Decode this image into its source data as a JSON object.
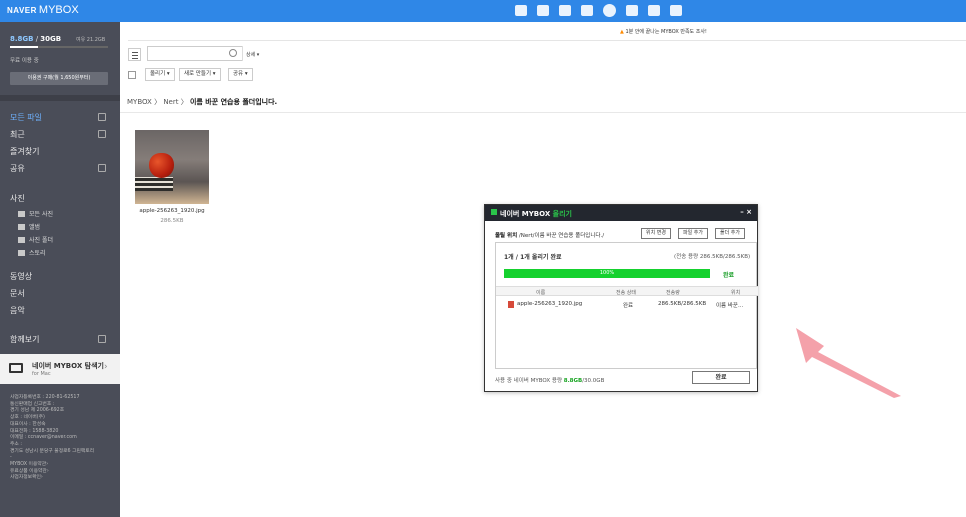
{
  "brand": {
    "naver": "NAVER",
    "mybox": "MYBOX"
  },
  "sidebar": {
    "quota_used": "8.8GB",
    "quota_sep": " / ",
    "quota_total": "30GB",
    "quota_small": "여유 21.2GB",
    "quota_fraction": 0.29,
    "free_text": "무료 이용 중",
    "buy_button": "이용권 구매(월 1,650원부터)",
    "nav": [
      "모든 파일",
      "최근",
      "즐겨찾기",
      "공유",
      "사진",
      "동영상",
      "문서",
      "음악",
      "함께보기"
    ],
    "photo_sub": [
      "모든 사진",
      "앨범",
      "사진 폴더",
      "스토리"
    ],
    "explorer_title": "네이버 MYBOX 탐색기",
    "explorer_sub": "for Mac",
    "footer": "사업자등록번호 : 220-81-62517\n통신판매업 신고번호 :\n경기 성남 제 2006-692호\n상호 : 네이버(주)\n대표이사 : 한성숙\n대표전화 : 1588-3820\n이메일 : ccnaver@naver.com\n주소 :\n경기도 성남시 분당구 불정로6 그린팩토리\n-\nMYBOX 이용약관›\n유료상품 이용약관›\n사업자정보확인›"
  },
  "notice": "1분 안에 끝나는 MYBOX 만족도 조사!",
  "toolbar": {
    "search_placeholder": "",
    "detail": "상세 ▾",
    "upload": "올리기 ▾",
    "new": "새로 만들기 ▾",
    "share": "공유 ▾"
  },
  "breadcrumb": {
    "root": "MYBOX",
    "sep": " 〉 ",
    "mid": "Nert",
    "current": "이름 바꾼 연습용 폴더입니다."
  },
  "file": {
    "name": "apple-256263_1920.jpg",
    "size": "286.5KB"
  },
  "dialog": {
    "title_a": "네이버 MYBOX",
    "title_b": " 올리기",
    "ctrl": "– ×",
    "path_label": "올릴 위치",
    "path": " /Nert/이름 바꾼 연습용 폴더입니다./",
    "btn_move": "위치 변경",
    "btn_file": "파일 추가",
    "btn_folder": "폴더 추가",
    "status": "1개 / 1개 올리기 완료",
    "transfer": "(전송 용량   286.5KB/286.5KB)",
    "progress": 100,
    "progress_label": "100%",
    "done": "완료",
    "columns": [
      "이름",
      "전송 상태",
      "전송량",
      "위치"
    ],
    "row": {
      "name": "apple-256263_1920.jpg",
      "state": "완료",
      "amount": "286.5KB/286.5KB",
      "location": "이름 바꾼..."
    },
    "footer_a": "사용 중 네이버 MYBOX 용량 ",
    "footer_b": "8.8GB",
    "footer_c": "/30.0GB",
    "ok": "완료"
  },
  "colors": {
    "brand": "#2f87e7",
    "success": "#15d12e",
    "sidebar": "#4a4d58"
  }
}
